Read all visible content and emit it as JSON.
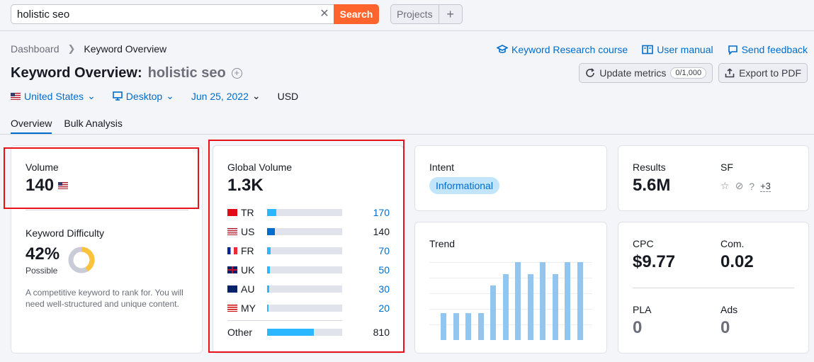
{
  "search": {
    "value": "holistic seo",
    "button": "Search"
  },
  "projects": {
    "label": "Projects",
    "plus": "+"
  },
  "breadcrumb": {
    "root": "Dashboard",
    "current": "Keyword Overview"
  },
  "links": {
    "course": "Keyword Research course",
    "manual": "User manual",
    "feedback": "Send feedback"
  },
  "title": {
    "prefix": "Keyword Overview:",
    "keyword": "holistic seo"
  },
  "actions": {
    "update": "Update metrics",
    "counter": "0/1,000",
    "export": "Export to PDF"
  },
  "filters": {
    "country": "United States",
    "device": "Desktop",
    "date": "Jun 25, 2022",
    "currency": "USD"
  },
  "tabs": [
    "Overview",
    "Bulk Analysis"
  ],
  "volume": {
    "label": "Volume",
    "value": "140"
  },
  "kd": {
    "label": "Keyword Difficulty",
    "value": "42%",
    "level": "Possible",
    "percent": 42,
    "desc": "A competitive keyword to rank for. You will need well-structured and unique content."
  },
  "global": {
    "label": "Global Volume",
    "value": "1.3K",
    "rows": [
      {
        "code": "TR",
        "value": "170",
        "fill": 0.12,
        "link": true,
        "flag": "tr"
      },
      {
        "code": "US",
        "value": "140",
        "fill": 0.1,
        "link": false,
        "flag": "us",
        "dark": true
      },
      {
        "code": "FR",
        "value": "70",
        "fill": 0.05,
        "link": true,
        "flag": "fr"
      },
      {
        "code": "UK",
        "value": "50",
        "fill": 0.04,
        "link": true,
        "flag": "uk"
      },
      {
        "code": "AU",
        "value": "30",
        "fill": 0.03,
        "link": true,
        "flag": "au"
      },
      {
        "code": "MY",
        "value": "20",
        "fill": 0.02,
        "link": true,
        "flag": "my"
      }
    ],
    "other": {
      "label": "Other",
      "value": "810",
      "fill": 0.62
    }
  },
  "intent": {
    "label": "Intent",
    "badge": "Informational"
  },
  "results": {
    "label": "Results",
    "value": "5.6M"
  },
  "sf": {
    "label": "SF",
    "more": "+3",
    "icons": [
      "star-icon",
      "link-icon",
      "question-icon"
    ]
  },
  "trend": {
    "label": "Trend",
    "values": [
      35,
      35,
      35,
      35,
      70,
      85,
      100,
      85,
      100,
      85,
      100,
      100
    ]
  },
  "cpc": {
    "label": "CPC",
    "value": "$9.77"
  },
  "com": {
    "label": "Com.",
    "value": "0.02"
  },
  "pla": {
    "label": "PLA",
    "value": "0"
  },
  "ads": {
    "label": "Ads",
    "value": "0"
  },
  "colors": {
    "accent": "#006dca",
    "search": "#ff642d",
    "bar": "#2bb7ff",
    "trend": "#93c6ef",
    "highlight": "#e8131a"
  }
}
